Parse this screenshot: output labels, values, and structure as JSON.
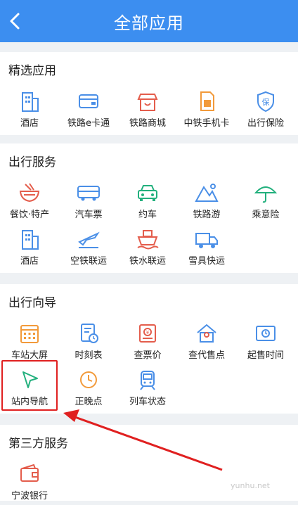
{
  "header": {
    "title": "全部应用",
    "back_icon": "chevron-left-icon"
  },
  "sections": [
    {
      "title": "精选应用",
      "items": [
        {
          "label": "酒店",
          "icon": "hotel-icon"
        },
        {
          "label": "铁路e卡通",
          "icon": "card-icon"
        },
        {
          "label": "铁路商城",
          "icon": "shop-icon"
        },
        {
          "label": "中铁手机卡",
          "icon": "sim-card-icon"
        },
        {
          "label": "出行保险",
          "icon": "insurance-icon"
        }
      ]
    },
    {
      "title": "出行服务",
      "items": [
        {
          "label": "餐饮·特产",
          "icon": "food-bowl-icon"
        },
        {
          "label": "汽车票",
          "icon": "bus-icon"
        },
        {
          "label": "约车",
          "icon": "car-icon"
        },
        {
          "label": "铁路游",
          "icon": "mountain-icon"
        },
        {
          "label": "乘意险",
          "icon": "umbrella-icon"
        },
        {
          "label": "酒店",
          "icon": "hotel-icon"
        },
        {
          "label": "空铁联运",
          "icon": "plane-icon"
        },
        {
          "label": "铁水联运",
          "icon": "ship-icon"
        },
        {
          "label": "雪具快运",
          "icon": "truck-icon"
        }
      ]
    },
    {
      "title": "出行向导",
      "items": [
        {
          "label": "车站大屏",
          "icon": "screen-icon"
        },
        {
          "label": "时刻表",
          "icon": "timetable-icon"
        },
        {
          "label": "查票价",
          "icon": "ticket-price-icon"
        },
        {
          "label": "查代售点",
          "icon": "agency-icon"
        },
        {
          "label": "起售时间",
          "icon": "sale-time-icon"
        },
        {
          "label": "站内导航",
          "icon": "navigation-icon"
        },
        {
          "label": "正晚点",
          "icon": "clock-icon"
        },
        {
          "label": "列车状态",
          "icon": "train-icon"
        }
      ]
    },
    {
      "title": "第三方服务",
      "items": [
        {
          "label": "宁波银行",
          "icon": "wallet-icon"
        }
      ]
    }
  ],
  "watermark": "yunhu.net",
  "colors": {
    "header": "#3c8ef0",
    "blue": "#4a8fe7",
    "red": "#e45d4c",
    "green": "#22b07d",
    "orange": "#f29a3a",
    "annotation": "#e02020"
  }
}
